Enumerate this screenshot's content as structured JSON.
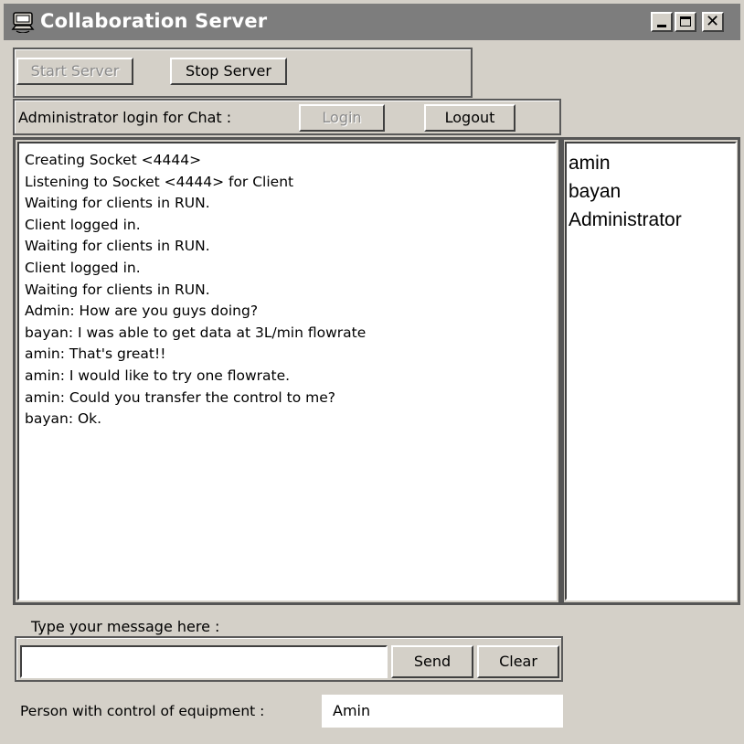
{
  "window": {
    "title": "Collaboration Server",
    "icon": "server-app-icon",
    "controls": {
      "minimize": "minimize-icon",
      "maximize": "maximize-icon",
      "close": "close-icon"
    }
  },
  "server": {
    "start_label": "Start Server",
    "start_enabled": false,
    "stop_label": "Stop Server"
  },
  "admin": {
    "label": "Administrator login for Chat :",
    "login_label": "Login",
    "login_enabled": false,
    "logout_label": "Logout"
  },
  "log": [
    "Creating Socket <4444>",
    "Listening to Socket <4444> for Client",
    "Waiting for clients in RUN.",
    "Client logged in.",
    "Waiting for clients in RUN.",
    "Client logged in.",
    "Waiting for clients in RUN.",
    "Admin: How are you guys doing?",
    "bayan: I was able to get data at 3L/min flowrate",
    "amin: That's great!!",
    "amin: I would like to try one flowrate.",
    "amin: Could you transfer the control to me?",
    "bayan: Ok."
  ],
  "users": [
    "amin",
    "bayan",
    "Administrator"
  ],
  "message": {
    "label": "Type your message here :",
    "value": "",
    "send_label": "Send",
    "clear_label": "Clear"
  },
  "control": {
    "label": "Person with control of equipment :",
    "value": "Amin"
  },
  "colors": {
    "window_bg": "#d4d0c8",
    "titlebar_bg": "#7d7d7d",
    "title_text": "#ffffff"
  }
}
